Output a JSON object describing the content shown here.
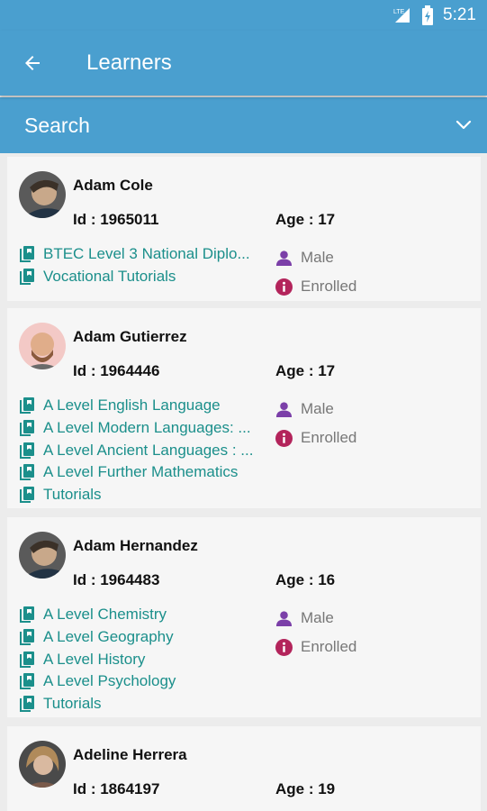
{
  "status_bar": {
    "time": "5:21",
    "network_label": "LTE"
  },
  "app_bar": {
    "title": "Learners"
  },
  "search": {
    "label": "Search"
  },
  "colors": {
    "primary": "#4a9fcf",
    "course_text": "#1b8f8b",
    "gender_icon": "#7b3fa8",
    "status_icon": "#b3245b"
  },
  "learners": [
    {
      "name": "Adam Cole",
      "id_text": "Id : 1965011",
      "age_text": "Age : 17",
      "gender": "Male",
      "status": "Enrolled",
      "courses": [
        "BTEC Level 3 National Diplo...",
        "Vocational Tutorials"
      ]
    },
    {
      "name": "Adam Gutierrez",
      "id_text": "Id : 1964446",
      "age_text": "Age : 17",
      "gender": "Male",
      "status": "Enrolled",
      "courses": [
        "A Level English Language",
        "A Level Modern Languages: ...",
        "A Level Ancient Languages : ...",
        "A Level Further Mathematics",
        "Tutorials"
      ]
    },
    {
      "name": "Adam Hernandez",
      "id_text": "Id : 1964483",
      "age_text": "Age : 16",
      "gender": "Male",
      "status": "Enrolled",
      "courses": [
        "A Level Chemistry",
        "A Level Geography",
        "A Level History",
        "A Level Psychology",
        "Tutorials"
      ]
    },
    {
      "name": "Adeline Herrera",
      "id_text": "Id : 1864197",
      "age_text": "Age : 19",
      "gender": "",
      "status": "",
      "courses": []
    }
  ]
}
